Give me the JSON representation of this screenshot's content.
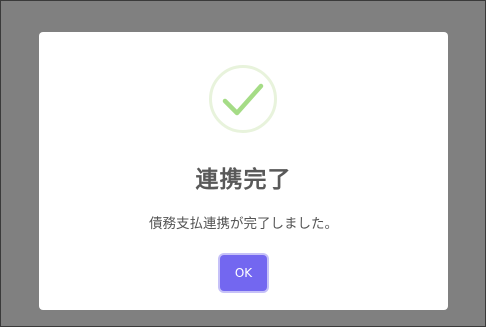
{
  "modal": {
    "icon": "success-checkmark-icon",
    "title": "連携完了",
    "message": "債務支払連携が完了しました。",
    "ok_label": "OK"
  },
  "colors": {
    "overlay": "#808080",
    "icon_ring": "#e8f3dc",
    "icon_check": "#a5dc86",
    "title_text": "#595959",
    "button": "#7367f0"
  }
}
